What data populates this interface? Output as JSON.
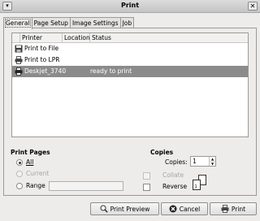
{
  "window": {
    "title": "Print",
    "menu_glyph": "▾",
    "close_glyph": "✕"
  },
  "tabs": [
    {
      "label": "General",
      "active": true
    },
    {
      "label": "Page Setup",
      "active": false
    },
    {
      "label": "Image Settings",
      "active": false
    },
    {
      "label": "Job",
      "active": false
    }
  ],
  "printers": {
    "columns": [
      "Printer",
      "Location",
      "Status"
    ],
    "rows": [
      {
        "name": "Print to File",
        "location": "",
        "status": "",
        "icon": "floppy-disk-icon",
        "selected": false
      },
      {
        "name": "Print to LPR",
        "location": "",
        "status": "",
        "icon": "printer-icon",
        "selected": false
      },
      {
        "name": "Deskjet_3740",
        "location": "",
        "status": "ready to print",
        "icon": "printer-icon",
        "selected": true
      }
    ]
  },
  "print_pages": {
    "title": "Print Pages",
    "all_label": "All",
    "current_label": "Current",
    "range_label": "Range",
    "selected": "All",
    "range_value": ""
  },
  "copies": {
    "title": "Copies",
    "copies_label": "Copies:",
    "copies_value": "1",
    "collate_label": "Collate",
    "collate_checked": false,
    "collate_enabled": false,
    "reverse_label": "Reverse",
    "reverse_checked": false
  },
  "buttons": {
    "print_preview": "Print Preview",
    "cancel": "Cancel",
    "print": "Print"
  },
  "colors": {
    "selected_row": "#8b8b8b",
    "dialog_bg": "#edeceb"
  }
}
